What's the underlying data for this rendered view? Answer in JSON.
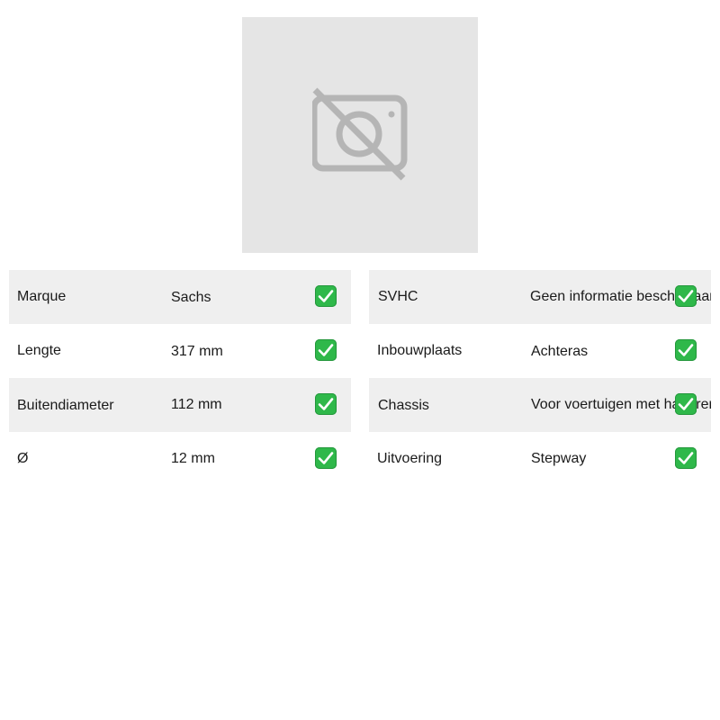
{
  "product_image": {
    "placeholder_icon": "no-photo-icon"
  },
  "specs_left": [
    {
      "label": "Marque",
      "value": "Sachs",
      "status_icon": "check-icon"
    },
    {
      "label": "Lengte",
      "value": "317 mm",
      "status_icon": "check-icon"
    },
    {
      "label": "Buitendiameter",
      "value": "112 mm",
      "status_icon": "check-icon"
    },
    {
      "label": "Ø",
      "value": "12 mm",
      "status_icon": "check-icon"
    }
  ],
  "specs_right": [
    {
      "label": "SVHC",
      "value": "Geen informatie beschikbaar",
      "status_icon": "check-icon"
    },
    {
      "label": "Inbouwplaats",
      "value": "Achteras",
      "status_icon": "check-icon"
    },
    {
      "label": "Chassis",
      "value": "Voor voertuigen met handrem",
      "status_icon": "check-icon"
    },
    {
      "label": "Uitvoering",
      "value": "Stepway",
      "status_icon": "check-icon"
    }
  ],
  "colors": {
    "row_shade": "#efefef",
    "image_bg": "#e5e5e5",
    "check_green": "#2fb84a"
  }
}
